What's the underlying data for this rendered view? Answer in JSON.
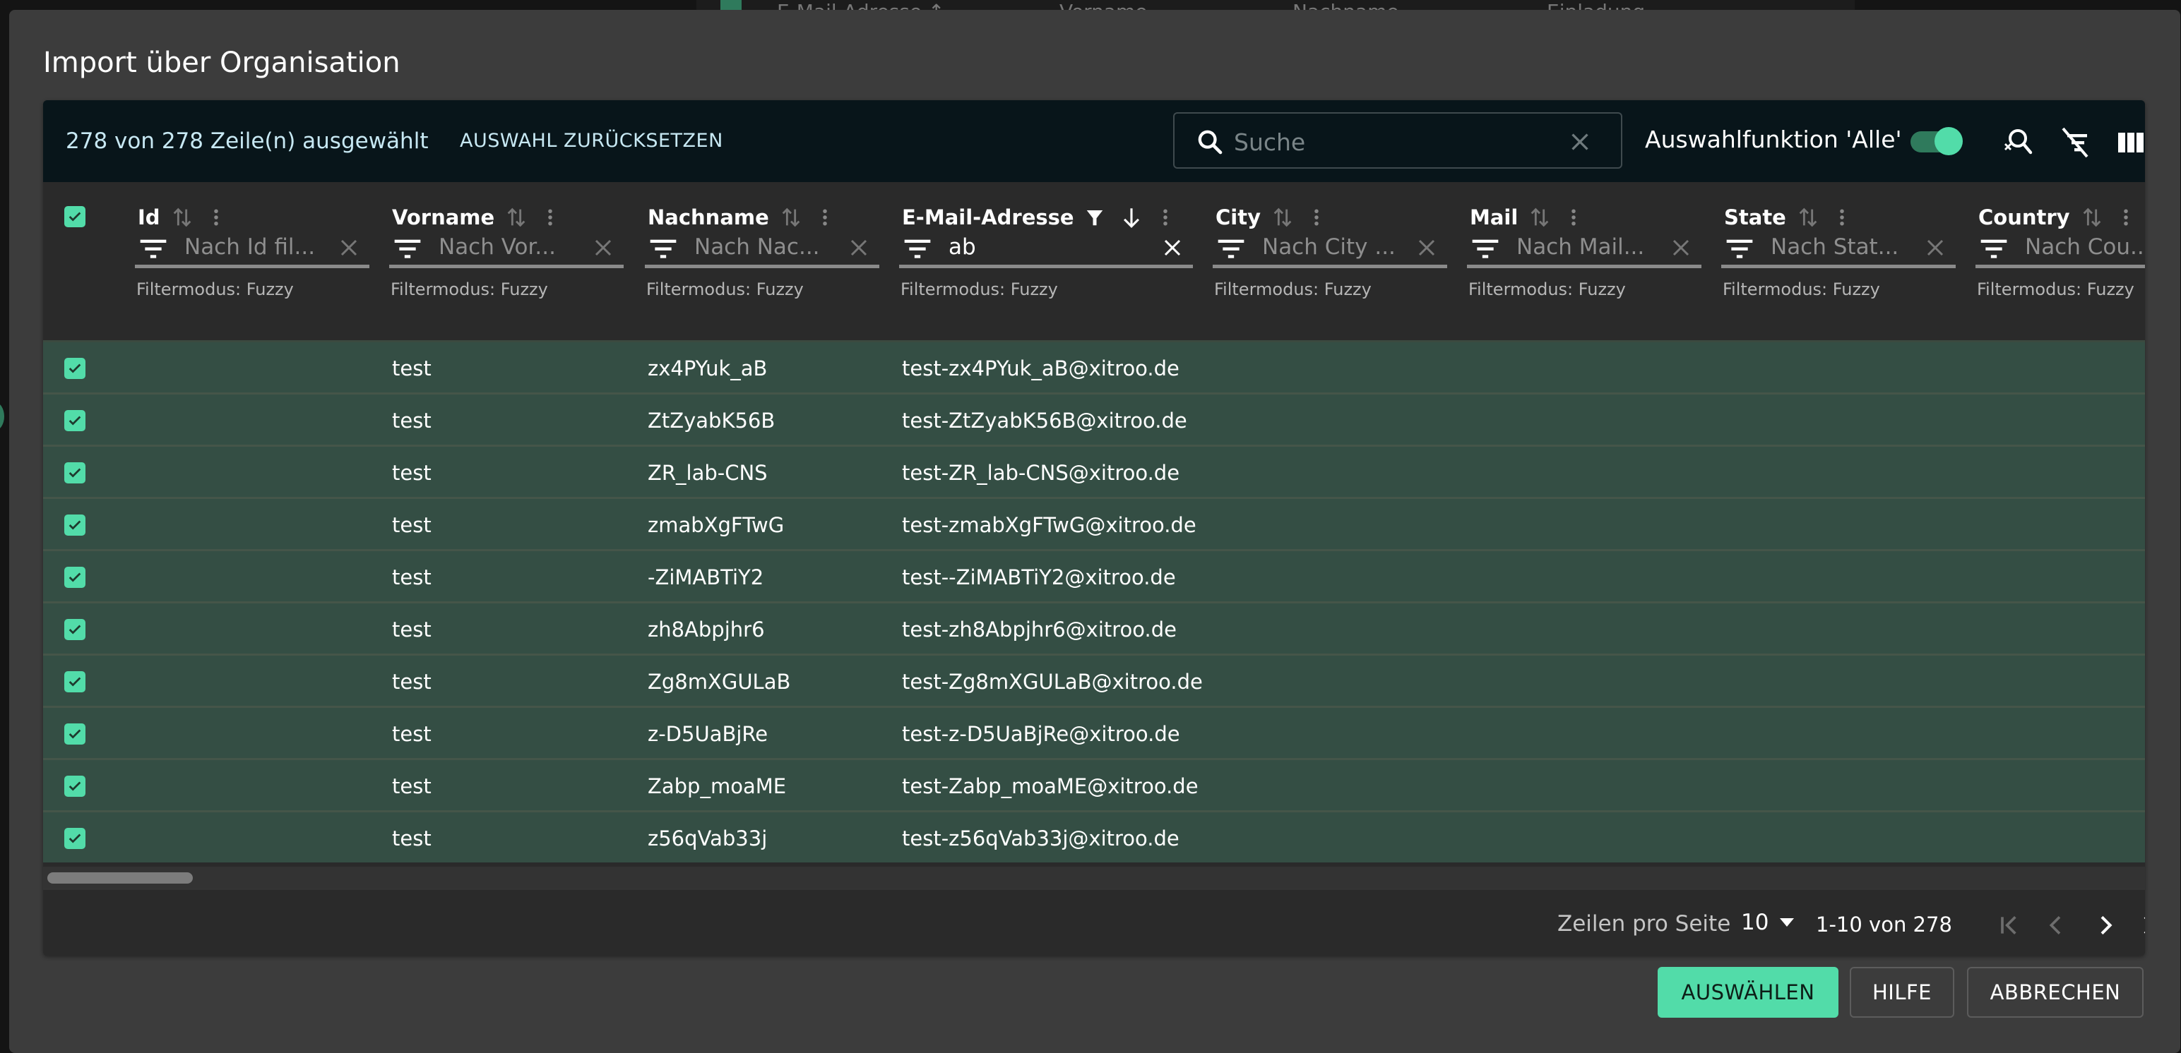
{
  "background": {
    "table_headers": [
      "E-Mail-Adresse ↑",
      "Vorname",
      "Nachname",
      "Einladung"
    ]
  },
  "dialog": {
    "title": "Import über Organisation"
  },
  "toolbar": {
    "selection_info": "278 von 278 Zeile(n) ausgewählt",
    "reset_selection_label": "AUSWAHL ZURÜCKSETZEN",
    "search": {
      "placeholder": "Suche",
      "value": ""
    },
    "toggle_label": "Auswahlfunktion 'Alle'",
    "toggle_on": true,
    "icons": [
      "search-clear-icon",
      "filter-off-icon",
      "view-columns-icon"
    ]
  },
  "columns": [
    {
      "key": "id",
      "label": "Id",
      "filter_placeholder": "Nach Id fil...",
      "filter_value": "",
      "filter_mode": "Filtermodus: Fuzzy",
      "sorted": false,
      "filtered": false
    },
    {
      "key": "vorname",
      "label": "Vorname",
      "filter_placeholder": "Nach Vor...",
      "filter_value": "",
      "filter_mode": "Filtermodus: Fuzzy",
      "sorted": false,
      "filtered": false
    },
    {
      "key": "nachname",
      "label": "Nachname",
      "filter_placeholder": "Nach Nac...",
      "filter_value": "",
      "filter_mode": "Filtermodus: Fuzzy",
      "sorted": false,
      "filtered": false
    },
    {
      "key": "email",
      "label": "E-Mail-Adresse",
      "filter_placeholder": "",
      "filter_value": "ab",
      "filter_mode": "Filtermodus: Fuzzy",
      "sorted": "desc",
      "filtered": true
    },
    {
      "key": "city",
      "label": "City",
      "filter_placeholder": "Nach City ...",
      "filter_value": "",
      "filter_mode": "Filtermodus: Fuzzy",
      "sorted": false,
      "filtered": false
    },
    {
      "key": "mail",
      "label": "Mail",
      "filter_placeholder": "Nach Mail...",
      "filter_value": "",
      "filter_mode": "Filtermodus: Fuzzy",
      "sorted": false,
      "filtered": false
    },
    {
      "key": "state",
      "label": "State",
      "filter_placeholder": "Nach Stat...",
      "filter_value": "",
      "filter_mode": "Filtermodus: Fuzzy",
      "sorted": false,
      "filtered": false
    },
    {
      "key": "country",
      "label": "Country",
      "filter_placeholder": "Nach Cou...",
      "filter_value": "",
      "filter_mode": "Filtermodus: Fuzzy",
      "sorted": false,
      "filtered": false
    }
  ],
  "rows": [
    {
      "selected": true,
      "id": "",
      "vorname": "test",
      "nachname": "zx4PYuk_aB",
      "email": "test-zx4PYuk_aB@xitroo.de"
    },
    {
      "selected": true,
      "id": "",
      "vorname": "test",
      "nachname": "ZtZyabK56B",
      "email": "test-ZtZyabK56B@xitroo.de"
    },
    {
      "selected": true,
      "id": "",
      "vorname": "test",
      "nachname": "ZR_lab-CNS",
      "email": "test-ZR_lab-CNS@xitroo.de"
    },
    {
      "selected": true,
      "id": "",
      "vorname": "test",
      "nachname": "zmabXgFTwG",
      "email": "test-zmabXgFTwG@xitroo.de"
    },
    {
      "selected": true,
      "id": "",
      "vorname": "test",
      "nachname": "-ZiMABTiY2",
      "email": "test--ZiMABTiY2@xitroo.de"
    },
    {
      "selected": true,
      "id": "",
      "vorname": "test",
      "nachname": "zh8Abpjhr6",
      "email": "test-zh8Abpjhr6@xitroo.de"
    },
    {
      "selected": true,
      "id": "",
      "vorname": "test",
      "nachname": "Zg8mXGULaB",
      "email": "test-Zg8mXGULaB@xitroo.de"
    },
    {
      "selected": true,
      "id": "",
      "vorname": "test",
      "nachname": "z-D5UaBjRe",
      "email": "test-z-D5UaBjRe@xitroo.de"
    },
    {
      "selected": true,
      "id": "",
      "vorname": "test",
      "nachname": "Zabp_moaME",
      "email": "test-Zabp_moaME@xitroo.de"
    },
    {
      "selected": true,
      "id": "",
      "vorname": "test",
      "nachname": "z56qVab33j",
      "email": "test-z56qVab33j@xitroo.de"
    }
  ],
  "pagination": {
    "rows_per_page_label": "Zeilen pro Seite",
    "rows_per_page": "10",
    "range": "1-10 von 278"
  },
  "actions": {
    "select_label": "AUSWÄHLEN",
    "help_label": "HILFE",
    "cancel_label": "ABBRECHEN"
  },
  "colors": {
    "accent": "#52dca9",
    "selected_row": "#344e44",
    "toolbar_bg": "#08151a",
    "dialog_bg": "#3c3c3c"
  }
}
